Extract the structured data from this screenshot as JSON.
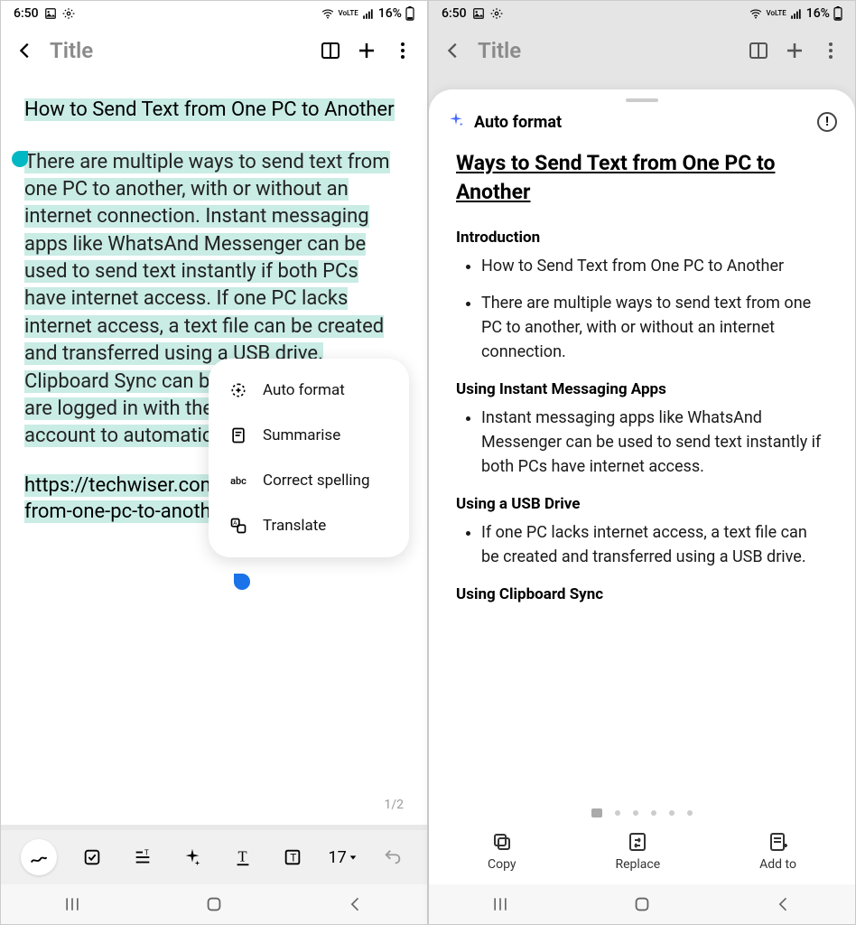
{
  "status": {
    "time": "6:50",
    "battery": "16%",
    "network": "VoLTE"
  },
  "header": {
    "title_placeholder": "Title"
  },
  "note": {
    "heading": "How to Send Text from One PC to Another",
    "body": "There are multiple ways to send text from one PC to another, with or without an internet connection. Instant messaging apps like WhatsAnd Messenger can be used to send text instantly if both PCs have internet access. If one PC lacks internet access, a text file can be created and transferred using a USB drive. Clipboard Sync can be enabled if both PCs are logged in with the same Microsoft account to automatically synchronise text.",
    "url": "https://techwiser.com/how-to-send-text-from-one-pc-to-another/",
    "page_indicator": "1/2"
  },
  "popup": {
    "auto_format": "Auto format",
    "summarise": "Summarise",
    "correct_spelling": "Correct spelling",
    "translate": "Translate"
  },
  "toolbar": {
    "font_size": "17"
  },
  "sheet": {
    "label": "Auto format",
    "title": "Ways to Send Text from One PC to Another",
    "sections": [
      {
        "heading": "Introduction",
        "items": [
          "How to Send Text from One PC to Another",
          "There are multiple ways to send text from one PC to another, with or without an internet connection."
        ]
      },
      {
        "heading": "Using Instant Messaging Apps",
        "items": [
          "Instant messaging apps like WhatsAnd Messenger can be used to send text instantly if both PCs have internet access."
        ]
      },
      {
        "heading": "Using a USB Drive",
        "items": [
          "If one PC lacks internet access, a text file can be created and transferred using a USB drive."
        ]
      },
      {
        "heading": "Using Clipboard Sync",
        "items": []
      }
    ],
    "actions": {
      "copy": "Copy",
      "replace": "Replace",
      "add_to": "Add to"
    }
  }
}
